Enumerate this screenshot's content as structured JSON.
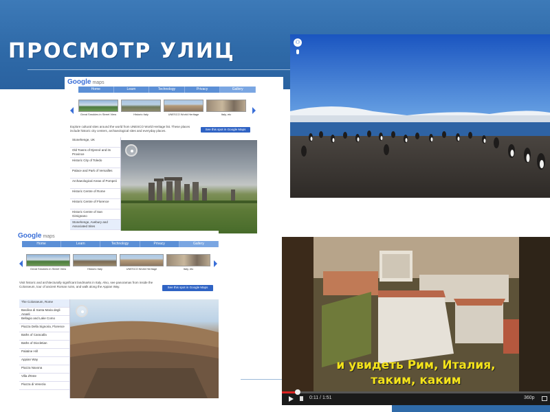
{
  "slide": {
    "title": "ПРОСМОТР УЛИЦ"
  },
  "maps_top": {
    "logo_google": "Google",
    "logo_maps": "maps",
    "nav": [
      "Home",
      "Learn",
      "Technology",
      "Privacy",
      "Gallery"
    ],
    "thumbs": [
      "Great Smokies in Street View",
      "Historic Italy",
      "UNESCO World Heritage",
      "Italy, etc"
    ],
    "description": "Explore cultural sites around the world from UNESCO World Heritage list. These places include historic city centers, archaeological sites and everyday places.",
    "see_button": "See this spot in Google Maps",
    "sidebar": [
      "Stonehenge, UK",
      "Old Towns of Djenné and its Province",
      "Historic City of Toledo",
      "Palace and Park of Versailles",
      "Archaeological Areas of Pompeii",
      "Historic Centre of Rome",
      "Historic Centre of Florence",
      "Historic Centre of San Gimignano",
      "Venice and its Lagoon",
      "Stonehenge, Avebury and Associated Sites"
    ]
  },
  "maps_bottom": {
    "logo_google": "Google",
    "logo_maps": "maps",
    "nav": [
      "Home",
      "Learn",
      "Technology",
      "Privacy",
      "Gallery"
    ],
    "thumbs": [
      "Great Smokies in Street View",
      "Historic Italy",
      "UNESCO World Heritage",
      "Italy, etc"
    ],
    "description": "Visit historic and architecturally significant landmarks in Italy. Also, see panoramas from inside the Colosseum, tour of ancient Roman ruins, and walk along the Appian Way.",
    "see_button": "See this spot in Google Maps",
    "sidebar": [
      "The Colosseum, Rome",
      "Basilica di Santa Maria degli Angeli",
      "Bellagio and Lake Como",
      "Piazza Della Signoria, Florence",
      "Baths of Caracalla",
      "Baths of Diocletian",
      "Palatine Hill",
      "Appian Way",
      "Piazza Navona",
      "Villa d'Este",
      "Piazza di Venezia"
    ]
  },
  "video": {
    "subtitle_line1": "и увидеть Рим, Италия,",
    "subtitle_line2": "таким, каким",
    "time": "0:11 / 1:51",
    "quality": "360p",
    "progress": 0.06
  },
  "colors": {
    "banner": "#2f6aa8",
    "subtitle": "#f3e21a"
  }
}
